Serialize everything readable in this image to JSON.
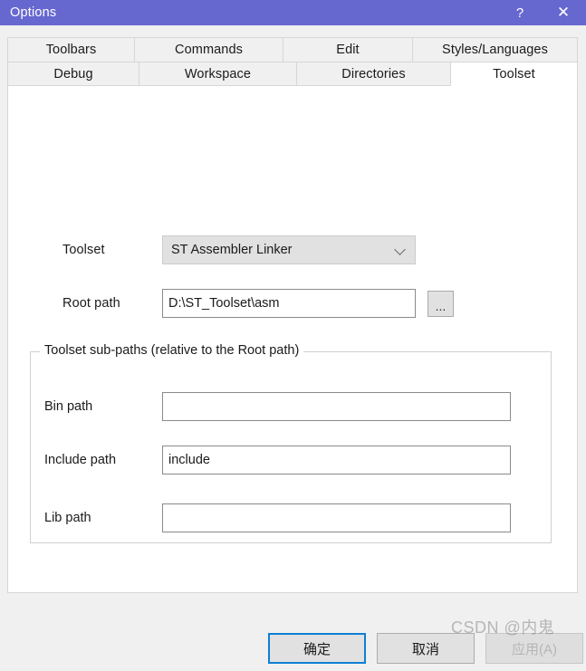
{
  "window": {
    "title": "Options",
    "help_button": "?",
    "close_button": "✕",
    "titlebar_color": "#6767d0"
  },
  "tabs": {
    "row1": [
      {
        "label": "Toolbars",
        "selected": false
      },
      {
        "label": "Commands",
        "selected": false
      },
      {
        "label": "Edit",
        "selected": false
      },
      {
        "label": "Styles/Languages",
        "selected": false
      }
    ],
    "row2": [
      {
        "label": "Debug",
        "selected": false
      },
      {
        "label": "Workspace",
        "selected": false
      },
      {
        "label": "Directories",
        "selected": false
      },
      {
        "label": "Toolset",
        "selected": true
      }
    ]
  },
  "toolset_page": {
    "toolset": {
      "label": "Toolset",
      "value": "ST Assembler Linker",
      "chevron_icon": "chevron-down-icon"
    },
    "root_path": {
      "label": "Root path",
      "value": "D:\\ST_Toolset\\asm",
      "placeholder": "",
      "browse_label": "..."
    },
    "subpaths_group": {
      "title": "Toolset sub-paths (relative to the Root path)",
      "fields": [
        {
          "label": "Bin path",
          "value": "",
          "placeholder": ""
        },
        {
          "label": "Include path",
          "value": "include",
          "placeholder": ""
        },
        {
          "label": "Lib path",
          "value": "",
          "placeholder": ""
        }
      ]
    }
  },
  "buttons": {
    "ok": "确定",
    "cancel": "取消",
    "apply": "应用(A)"
  },
  "watermark": "CSDN @内鬼"
}
